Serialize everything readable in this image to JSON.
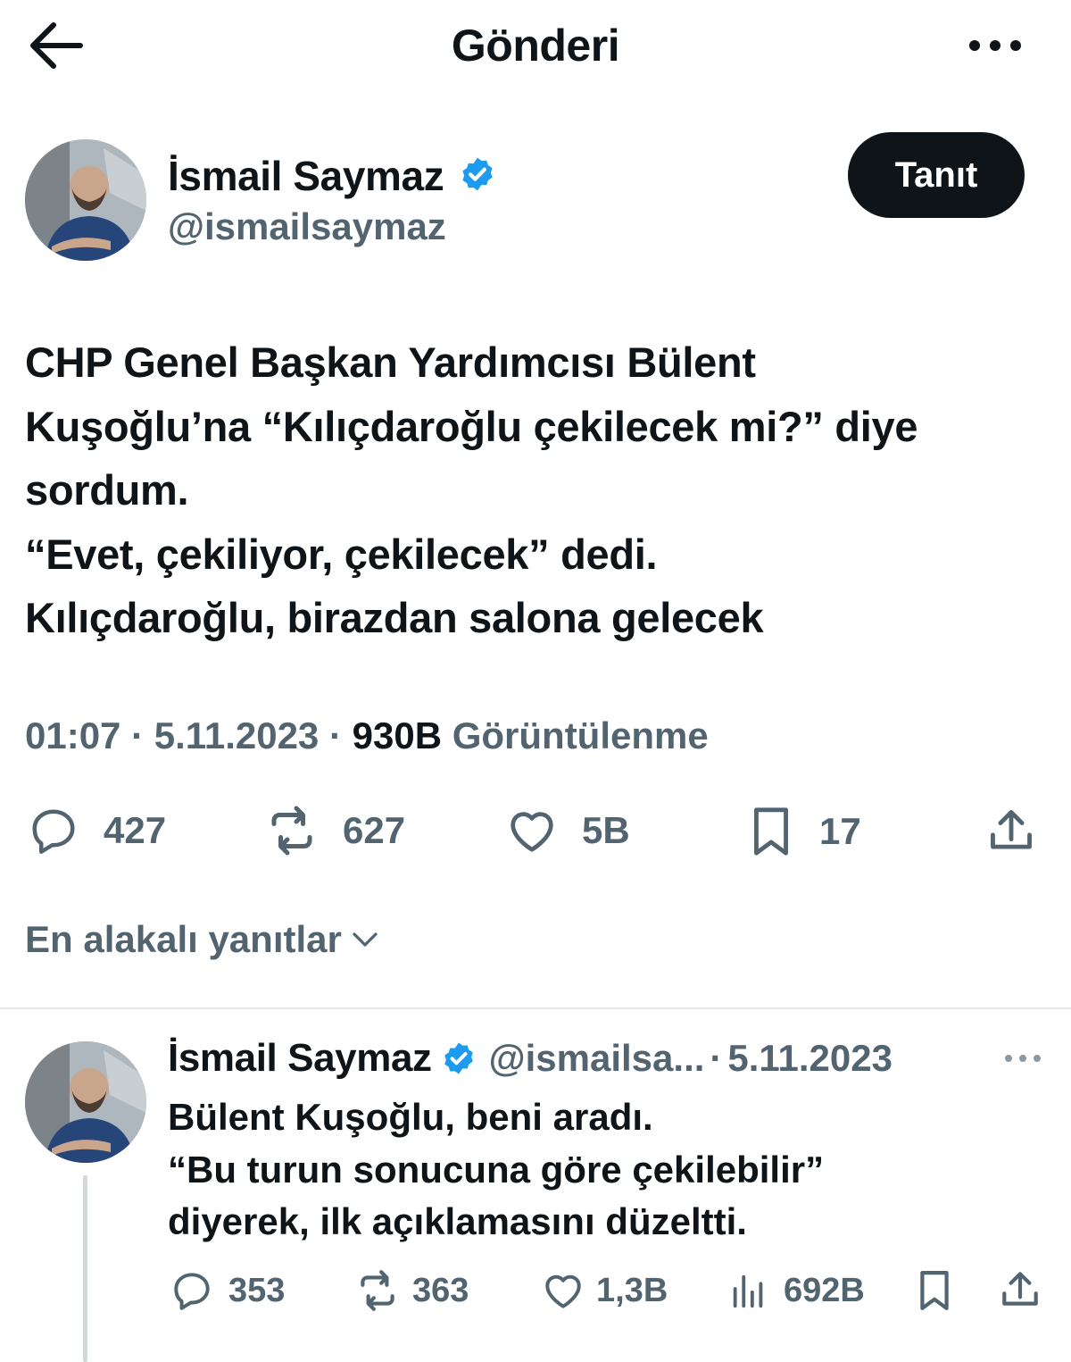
{
  "header": {
    "title": "Gönderi",
    "back_icon": "arrow-left-icon",
    "more_icon": "more-horizontal-icon"
  },
  "tweet": {
    "author": {
      "name": "İsmail Saymaz",
      "handle": "@ismailsaymaz",
      "verified": true,
      "verified_color": "#1d9bf0"
    },
    "follow_button": "Tanıt",
    "text_lines": [
      "CHP Genel Başkan Yardımcısı Bülent",
      "Kuşoğlu’na “Kılıçdaroğlu çekilecek mi?” diye",
      "sordum.",
      "“Evet, çekiliyor, çekilecek” dedi.",
      "Kılıçdaroğlu, birazdan salona gelecek"
    ],
    "time": "01:07",
    "date": "5.11.2023",
    "separator": "·",
    "views_count": "930B",
    "views_label": "Görüntülenme",
    "actions": {
      "replies": "427",
      "reposts": "627",
      "likes": "5B",
      "bookmarks": "17"
    }
  },
  "replies_sort": {
    "label": "En alakalı yanıtlar",
    "icon": "chevron-down-icon"
  },
  "reply": {
    "author_name": "İsmail Saymaz",
    "handle": "@ismailsa...",
    "separator": "·",
    "date": "5.11.2023",
    "text_lines": [
      "Bülent Kuşoğlu, beni aradı.",
      "“Bu turun sonucuna göre çekilebilir”",
      "diyerek, ilk açıklamasını düzeltti."
    ],
    "actions": {
      "replies": "353",
      "reposts": "363",
      "likes": "1,3B",
      "views": "692B"
    }
  },
  "colors": {
    "text": "#0f1419",
    "secondary": "#536471",
    "accent": "#1d9bf0",
    "button_bg": "#0f1419"
  }
}
